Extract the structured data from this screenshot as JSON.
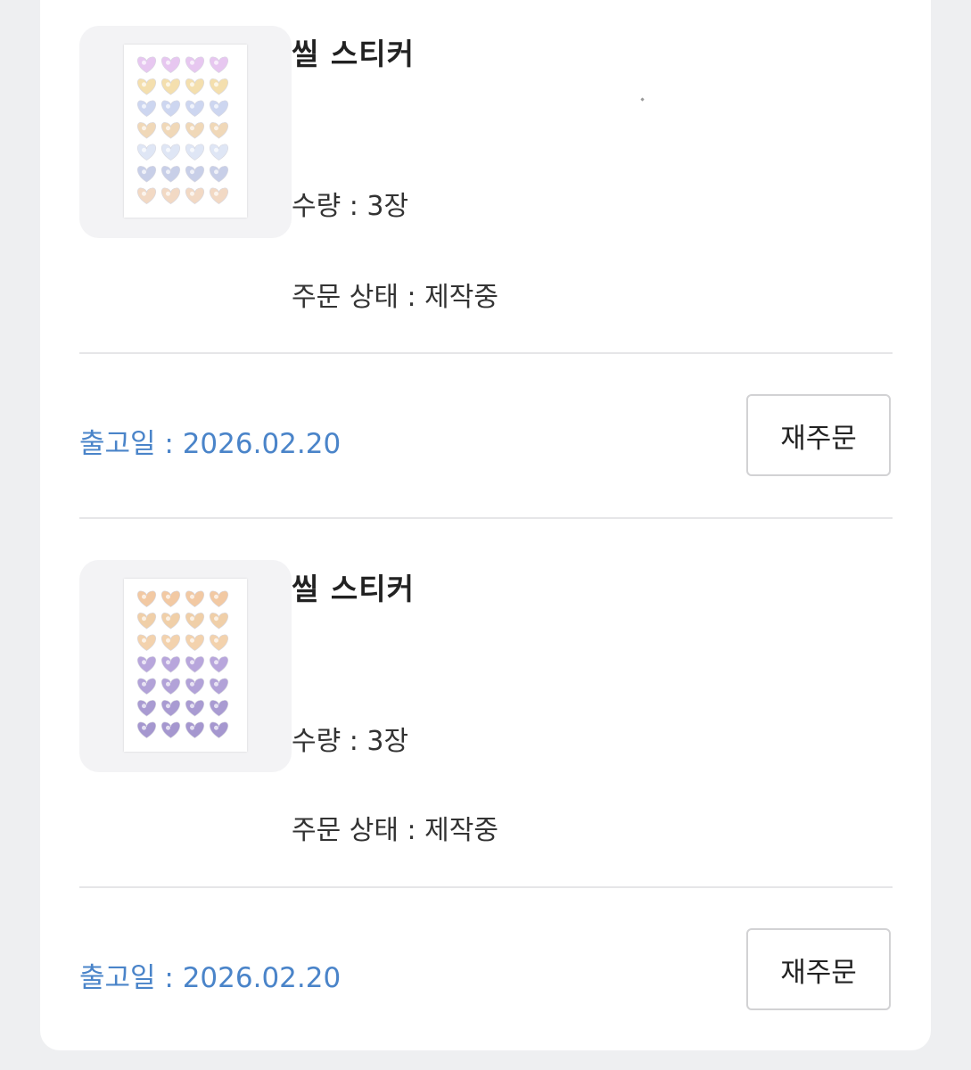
{
  "orders": [
    {
      "title": "씰 스티커",
      "quantity": "수량 : 3장",
      "status": "주문 상태 : 제작중",
      "ship_date": "출고일 : 2026.02.20",
      "reorder_label": "재주문",
      "sheet_colors": [
        "#e7c7f0",
        "#f4dfae",
        "#cdd6f0",
        "#f0d8b8",
        "#dfe6f5",
        "#c8cfe8",
        "#f2d9c4"
      ]
    },
    {
      "title": "씰 스티커",
      "quantity": "수량 : 3장",
      "status": "주문 상태 : 제작중",
      "ship_date": "출고일 : 2026.02.20",
      "reorder_label": "재주문",
      "sheet_colors": [
        "#f2c9a3",
        "#f0cfa8",
        "#f3d2ad",
        "#b8a6dc",
        "#b2a2d8",
        "#a99bd2",
        "#a597cf"
      ]
    }
  ],
  "colors": {
    "ship_date": "#4a84c9",
    "card_bg": "#ffffff",
    "page_bg": "#eeeff1"
  }
}
